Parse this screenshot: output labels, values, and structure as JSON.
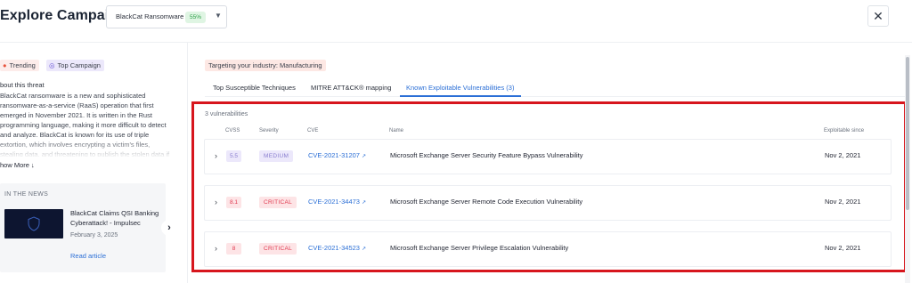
{
  "header": {
    "title": "Explore Campaigns:",
    "campaign_select": {
      "value": "BlackCat Ransomware",
      "badge": "55%",
      "chevron_icon": "chevron-down-icon"
    },
    "close_icon": "close-icon"
  },
  "left": {
    "tags": [
      {
        "label": "Trending",
        "icon": "fire-icon"
      },
      {
        "label": "Top Campaign",
        "icon": "target-icon"
      }
    ],
    "about_heading": "bout this threat",
    "about_text": "BlackCat ransomware is a new and sophisticated ransomware-as-a-service (RaaS) operation that first emerged in November 2021. It is written in the Rust programming language, making it more difficult to detect and analyze. BlackCat is known for its use of triple extortion, which involves encrypting a victim's files, stealing data, and threatening to publish the stolen data if the",
    "show_more": "how More",
    "news": {
      "heading": "IN THE NEWS",
      "title": "BlackCat Claims QSI Banking Cyberattack! - Impulsec",
      "date": "February 3, 2025",
      "link": "Read article"
    }
  },
  "main": {
    "industry_tag": "Targeting your industry: Manufacturing",
    "tabs": [
      {
        "label": "Top Susceptible Techniques",
        "active": false
      },
      {
        "label": "MITRE ATT&CK® mapping",
        "active": false
      },
      {
        "label": "Known Exploitable Vulnerabilities (3)",
        "active": true
      }
    ],
    "count_label": "3 vulnerabilities",
    "columns": [
      "CVSS",
      "Severity",
      "CVE",
      "Name",
      "Exploitable since"
    ],
    "rows": [
      {
        "cvss": "5.5",
        "severity": "MEDIUM",
        "cve": "CVE-2021-31207",
        "name": "Microsoft Exchange Server Security Feature Bypass Vulnerability",
        "since": "Nov 2, 2021"
      },
      {
        "cvss": "8.1",
        "severity": "CRITICAL",
        "cve": "CVE-2021-34473",
        "name": "Microsoft Exchange Server Remote Code Execution Vulnerability",
        "since": "Nov 2, 2021"
      },
      {
        "cvss": "8",
        "severity": "CRITICAL",
        "cve": "CVE-2021-34523",
        "name": "Microsoft Exchange Server Privilege Escalation Vulnerability",
        "since": "Nov 2, 2021"
      }
    ]
  },
  "colors": {
    "accent": "#2b6fd6",
    "highlight_box": "#d7161d",
    "medium_bg": "#ece8fb",
    "medium_text": "#8a7fd0",
    "critical_bg": "#fde4e6",
    "critical_text": "#e0394f"
  }
}
